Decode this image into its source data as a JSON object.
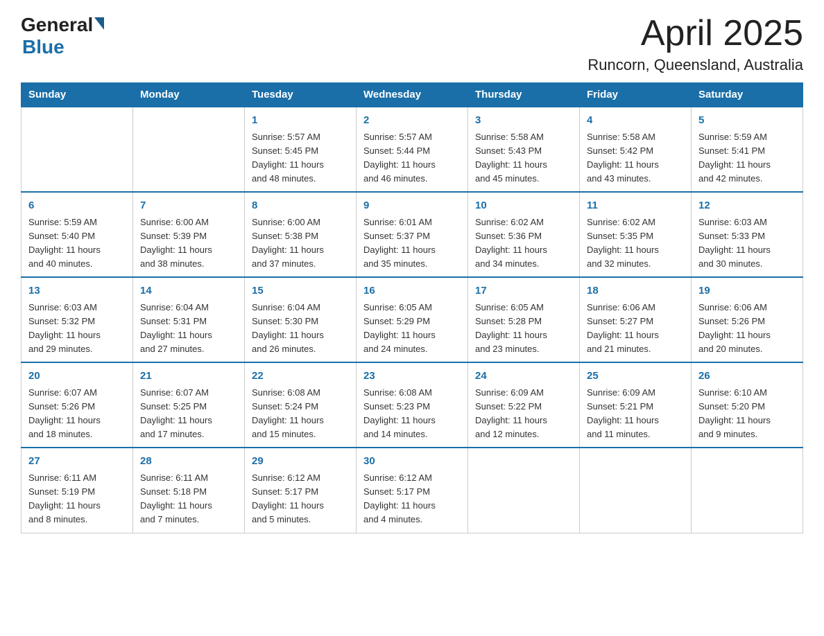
{
  "header": {
    "logo_general": "General",
    "logo_blue": "Blue",
    "title": "April 2025",
    "subtitle": "Runcorn, Queensland, Australia"
  },
  "days_of_week": [
    "Sunday",
    "Monday",
    "Tuesday",
    "Wednesday",
    "Thursday",
    "Friday",
    "Saturday"
  ],
  "weeks": [
    [
      {
        "day": "",
        "info": ""
      },
      {
        "day": "",
        "info": ""
      },
      {
        "day": "1",
        "info": "Sunrise: 5:57 AM\nSunset: 5:45 PM\nDaylight: 11 hours\nand 48 minutes."
      },
      {
        "day": "2",
        "info": "Sunrise: 5:57 AM\nSunset: 5:44 PM\nDaylight: 11 hours\nand 46 minutes."
      },
      {
        "day": "3",
        "info": "Sunrise: 5:58 AM\nSunset: 5:43 PM\nDaylight: 11 hours\nand 45 minutes."
      },
      {
        "day": "4",
        "info": "Sunrise: 5:58 AM\nSunset: 5:42 PM\nDaylight: 11 hours\nand 43 minutes."
      },
      {
        "day": "5",
        "info": "Sunrise: 5:59 AM\nSunset: 5:41 PM\nDaylight: 11 hours\nand 42 minutes."
      }
    ],
    [
      {
        "day": "6",
        "info": "Sunrise: 5:59 AM\nSunset: 5:40 PM\nDaylight: 11 hours\nand 40 minutes."
      },
      {
        "day": "7",
        "info": "Sunrise: 6:00 AM\nSunset: 5:39 PM\nDaylight: 11 hours\nand 38 minutes."
      },
      {
        "day": "8",
        "info": "Sunrise: 6:00 AM\nSunset: 5:38 PM\nDaylight: 11 hours\nand 37 minutes."
      },
      {
        "day": "9",
        "info": "Sunrise: 6:01 AM\nSunset: 5:37 PM\nDaylight: 11 hours\nand 35 minutes."
      },
      {
        "day": "10",
        "info": "Sunrise: 6:02 AM\nSunset: 5:36 PM\nDaylight: 11 hours\nand 34 minutes."
      },
      {
        "day": "11",
        "info": "Sunrise: 6:02 AM\nSunset: 5:35 PM\nDaylight: 11 hours\nand 32 minutes."
      },
      {
        "day": "12",
        "info": "Sunrise: 6:03 AM\nSunset: 5:33 PM\nDaylight: 11 hours\nand 30 minutes."
      }
    ],
    [
      {
        "day": "13",
        "info": "Sunrise: 6:03 AM\nSunset: 5:32 PM\nDaylight: 11 hours\nand 29 minutes."
      },
      {
        "day": "14",
        "info": "Sunrise: 6:04 AM\nSunset: 5:31 PM\nDaylight: 11 hours\nand 27 minutes."
      },
      {
        "day": "15",
        "info": "Sunrise: 6:04 AM\nSunset: 5:30 PM\nDaylight: 11 hours\nand 26 minutes."
      },
      {
        "day": "16",
        "info": "Sunrise: 6:05 AM\nSunset: 5:29 PM\nDaylight: 11 hours\nand 24 minutes."
      },
      {
        "day": "17",
        "info": "Sunrise: 6:05 AM\nSunset: 5:28 PM\nDaylight: 11 hours\nand 23 minutes."
      },
      {
        "day": "18",
        "info": "Sunrise: 6:06 AM\nSunset: 5:27 PM\nDaylight: 11 hours\nand 21 minutes."
      },
      {
        "day": "19",
        "info": "Sunrise: 6:06 AM\nSunset: 5:26 PM\nDaylight: 11 hours\nand 20 minutes."
      }
    ],
    [
      {
        "day": "20",
        "info": "Sunrise: 6:07 AM\nSunset: 5:26 PM\nDaylight: 11 hours\nand 18 minutes."
      },
      {
        "day": "21",
        "info": "Sunrise: 6:07 AM\nSunset: 5:25 PM\nDaylight: 11 hours\nand 17 minutes."
      },
      {
        "day": "22",
        "info": "Sunrise: 6:08 AM\nSunset: 5:24 PM\nDaylight: 11 hours\nand 15 minutes."
      },
      {
        "day": "23",
        "info": "Sunrise: 6:08 AM\nSunset: 5:23 PM\nDaylight: 11 hours\nand 14 minutes."
      },
      {
        "day": "24",
        "info": "Sunrise: 6:09 AM\nSunset: 5:22 PM\nDaylight: 11 hours\nand 12 minutes."
      },
      {
        "day": "25",
        "info": "Sunrise: 6:09 AM\nSunset: 5:21 PM\nDaylight: 11 hours\nand 11 minutes."
      },
      {
        "day": "26",
        "info": "Sunrise: 6:10 AM\nSunset: 5:20 PM\nDaylight: 11 hours\nand 9 minutes."
      }
    ],
    [
      {
        "day": "27",
        "info": "Sunrise: 6:11 AM\nSunset: 5:19 PM\nDaylight: 11 hours\nand 8 minutes."
      },
      {
        "day": "28",
        "info": "Sunrise: 6:11 AM\nSunset: 5:18 PM\nDaylight: 11 hours\nand 7 minutes."
      },
      {
        "day": "29",
        "info": "Sunrise: 6:12 AM\nSunset: 5:17 PM\nDaylight: 11 hours\nand 5 minutes."
      },
      {
        "day": "30",
        "info": "Sunrise: 6:12 AM\nSunset: 5:17 PM\nDaylight: 11 hours\nand 4 minutes."
      },
      {
        "day": "",
        "info": ""
      },
      {
        "day": "",
        "info": ""
      },
      {
        "day": "",
        "info": ""
      }
    ]
  ]
}
